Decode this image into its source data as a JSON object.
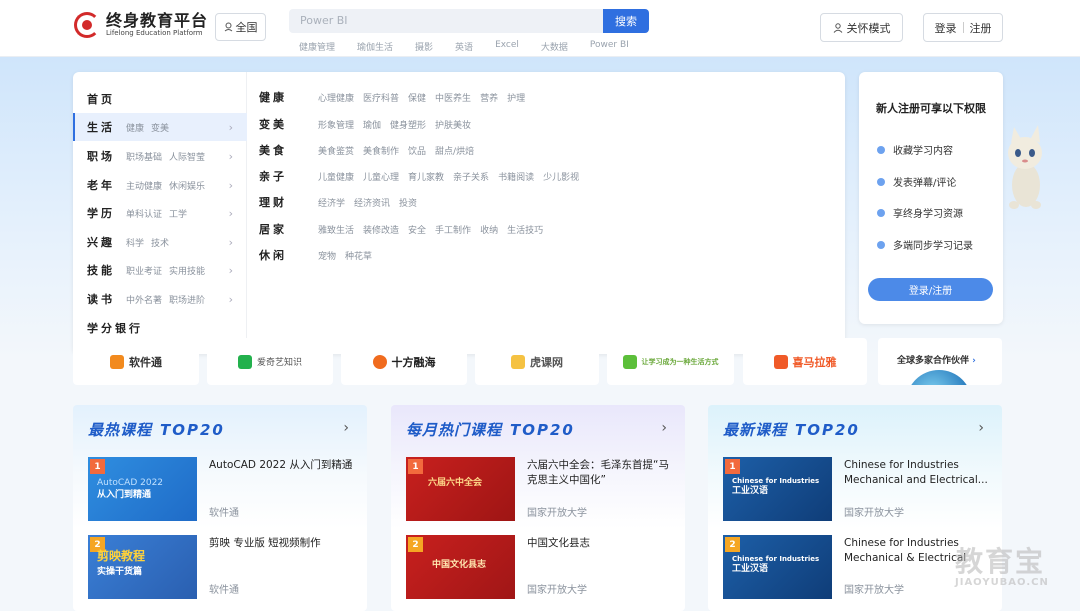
{
  "header": {
    "logo_title": "终身教育平台",
    "logo_sub": "Lifelong Education Platform",
    "region": "全国",
    "search_placeholder": "Power BI",
    "search_button": "搜索",
    "hotwords": [
      "健康管理",
      "瑜伽生活",
      "摄影",
      "英语",
      "Excel",
      "大数据",
      "Power BI"
    ],
    "care_mode": "关怀模式",
    "login": "登录",
    "register": "注册"
  },
  "menu": {
    "left": [
      {
        "title": "首页",
        "subs": []
      },
      {
        "title": "生活",
        "subs": [
          "健康",
          "变美"
        ]
      },
      {
        "title": "职场",
        "subs": [
          "职场基础",
          "人际智莹"
        ]
      },
      {
        "title": "老年",
        "subs": [
          "主动健康",
          "休闲娱乐"
        ]
      },
      {
        "title": "学历",
        "subs": [
          "单科认证",
          "工学"
        ]
      },
      {
        "title": "兴趣",
        "subs": [
          "科学",
          "技术"
        ]
      },
      {
        "title": "技能",
        "subs": [
          "职业考证",
          "实用技能"
        ]
      },
      {
        "title": "读书",
        "subs": [
          "中外名著",
          "职场进阶"
        ]
      },
      {
        "title": "学分银行",
        "subs": []
      }
    ],
    "right": [
      {
        "title": "健康",
        "links": [
          "心理健康",
          "医疗科普",
          "保健",
          "中医养生",
          "营养",
          "护理"
        ]
      },
      {
        "title": "变美",
        "links": [
          "形象管理",
          "瑜伽",
          "健身塑形",
          "护肤美妆"
        ]
      },
      {
        "title": "美食",
        "links": [
          "美食鉴赏",
          "美食制作",
          "饮品",
          "甜点/烘焙"
        ]
      },
      {
        "title": "亲子",
        "links": [
          "儿童健康",
          "儿童心理",
          "育儿家教",
          "亲子关系",
          "书籍阅读",
          "少儿影视"
        ]
      },
      {
        "title": "理财",
        "links": [
          "经济学",
          "经济资讯",
          "投资"
        ]
      },
      {
        "title": "居家",
        "links": [
          "雅致生活",
          "装修改造",
          "安全",
          "手工制作",
          "收纳",
          "生活技巧"
        ]
      },
      {
        "title": "休闲",
        "links": [
          "宠物",
          "种花草"
        ]
      }
    ]
  },
  "register_panel": {
    "title": "新人注册可享以下权限",
    "items": [
      "收藏学习内容",
      "发表弹幕/评论",
      "享终身学习资源",
      "多端同步学习记录"
    ],
    "button": "登录/注册"
  },
  "partners": [
    "软件通",
    "爱奇艺知识",
    "十方融海",
    "虎课网",
    "让学习成为一种生活方式",
    "喜马拉雅"
  ],
  "partners_more": "全球多家合作伙伴",
  "columns": [
    {
      "title": "最热课程",
      "top": "TOP20",
      "courses": [
        {
          "rank": "1",
          "thumb": [
            "AutoCAD 2022",
            "从入门到精通"
          ],
          "title": "AutoCAD 2022 从入门到精通",
          "source": "软件通"
        },
        {
          "rank": "2",
          "thumb": [
            "剪映教程",
            "实操干货篇"
          ],
          "title": "剪映 专业版 短视频制作",
          "source": "软件通"
        }
      ]
    },
    {
      "title": "每月热门课程",
      "top": "TOP20",
      "courses": [
        {
          "rank": "1",
          "thumb": [
            "六届六中全会"
          ],
          "title": "六届六中全会：毛泽东首提“马克思主义中国化”",
          "source": "国家开放大学"
        },
        {
          "rank": "2",
          "thumb": [
            "中国文化县志"
          ],
          "title": "中国文化县志",
          "source": "国家开放大学"
        }
      ]
    },
    {
      "title": "最新课程",
      "top": "TOP20",
      "courses": [
        {
          "rank": "1",
          "thumb": [
            "Chinese for Industries",
            "工业汉语"
          ],
          "title": "Chinese for Industries Mechanical and Electrical...",
          "source": "国家开放大学"
        },
        {
          "rank": "2",
          "thumb": [
            "Chinese for Industries",
            "工业汉语"
          ],
          "title": "Chinese for Industries Mechanical & Electrical",
          "source": "国家开放大学"
        }
      ]
    }
  ],
  "watermark": {
    "cn": "教育宝",
    "en": "JIAOYUBAO.CN"
  },
  "colors": {
    "accent": "#2f6fe0",
    "brand_red": "#d22a2a",
    "title_blue": "#1f5cc8"
  }
}
